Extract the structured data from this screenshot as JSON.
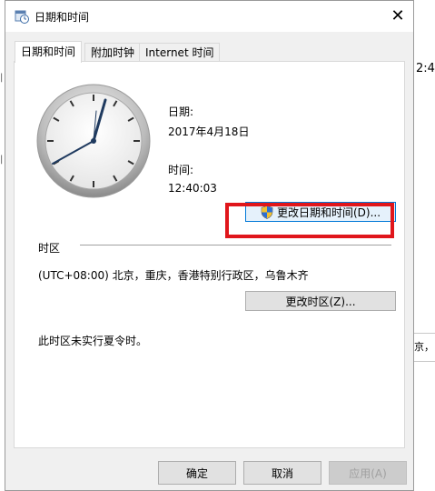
{
  "background": {
    "clock_fragment": "2:4",
    "popup_fragment": "京，"
  },
  "dialog": {
    "title": "日期和时间",
    "close_glyph": "✕"
  },
  "tabs": [
    {
      "label": "日期和时间",
      "active": true
    },
    {
      "label": "附加时钟",
      "active": false
    },
    {
      "label": "Internet 时间",
      "active": false
    }
  ],
  "datetime": {
    "date_label": "日期:",
    "date_value": "2017年4月18日",
    "time_label": "时间:",
    "time_value": "12:40:03",
    "change_button": "更改日期和时间(D)..."
  },
  "timezone": {
    "section_label": "时区",
    "value": "(UTC+08:00) 北京，重庆，香港特别行政区，乌鲁木齐",
    "change_button": "更改时区(Z)...",
    "dst_note": "此时区未实行夏令时。"
  },
  "footer": {
    "ok": "确定",
    "cancel": "取消",
    "apply": "应用(A)"
  },
  "icons": {
    "title": "calendar-clock-icon",
    "shield": "uac-shield-icon"
  },
  "colors": {
    "highlight": "#e0161b",
    "dialog_bg": "#f0f0f0",
    "panel_bg": "#ffffff"
  }
}
